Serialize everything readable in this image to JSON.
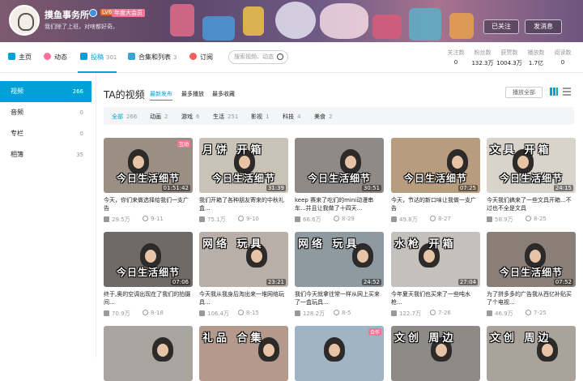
{
  "header": {
    "username": "摸鱼事务所",
    "level": "LV6",
    "vip_badge": "年度大会员",
    "signature": "我们除了上班，对啥都好奇。",
    "follow_label": "已关注",
    "message_label": "发消息"
  },
  "nav": {
    "items": [
      {
        "label": "主页",
        "count": ""
      },
      {
        "label": "动态",
        "count": ""
      },
      {
        "label": "投稿",
        "count": "301"
      },
      {
        "label": "合集和列表",
        "count": "3"
      },
      {
        "label": "订阅",
        "count": ""
      }
    ],
    "search_placeholder": "搜索视频、动态",
    "stats": [
      {
        "label": "关注数",
        "value": "0"
      },
      {
        "label": "粉丝数",
        "value": "132.3万"
      },
      {
        "label": "获赞数",
        "value": "1004.3万"
      },
      {
        "label": "播放数",
        "value": "1.7亿"
      },
      {
        "label": "阅读数",
        "value": "0"
      }
    ]
  },
  "sidebar": {
    "items": [
      {
        "label": "视频",
        "count": "266"
      },
      {
        "label": "音频",
        "count": "0"
      },
      {
        "label": "专栏",
        "count": "0"
      },
      {
        "label": "相簿",
        "count": "35"
      }
    ]
  },
  "main": {
    "title": "TA的视频",
    "sorts": [
      "最新发布",
      "最多播放",
      "最多收藏"
    ],
    "play_all_label": "播放全部",
    "filters": [
      {
        "label": "全部",
        "count": "266"
      },
      {
        "label": "动画",
        "count": "2"
      },
      {
        "label": "游戏",
        "count": "6"
      },
      {
        "label": "生活",
        "count": "251"
      },
      {
        "label": "影视",
        "count": "1"
      },
      {
        "label": "科技",
        "count": "4"
      },
      {
        "label": "美食",
        "count": "2"
      }
    ],
    "videos": [
      {
        "cap": "今日生活细节",
        "top": "",
        "tag": "互动",
        "duration": "01:51:42",
        "title": "今天，你们来做选择给我们一支广告",
        "plays": "29.5万",
        "date": "9-11"
      },
      {
        "cap": "今日生活细节",
        "top": "月饼 开箱",
        "tag": "",
        "duration": "31:39",
        "title": "我们开箱了各种朋友寄来的中秋礼盒...",
        "plays": "75.1万",
        "date": "9-10"
      },
      {
        "cap": "今日生活细节",
        "top": "",
        "tag": "",
        "duration": "30:51",
        "title": "keep 赛来了吃们的mini动漫串车...并且让我做了十四天...",
        "plays": "66.6万",
        "date": "8-29"
      },
      {
        "cap": "今日生活细节",
        "top": "",
        "tag": "",
        "duration": "07:25",
        "title": "今天，节达的新口味让我做一支广告",
        "plays": "49.8万",
        "date": "8-27"
      },
      {
        "cap": "今日生活细节",
        "top": "文具 开箱",
        "tag": "",
        "duration": "24:15",
        "title": "今天我们搞来了一些文具开箱...不过也不全是文具",
        "plays": "58.9万",
        "date": "8-25"
      },
      {
        "cap": "今日生活细节",
        "top": "",
        "tag": "",
        "duration": "07:06",
        "title": "终于,奥的空调出现在了我们的拍摄间...",
        "plays": "70.9万",
        "date": "8-18"
      },
      {
        "cap": "",
        "top": "网络 玩具",
        "tag": "",
        "duration": "23:21",
        "title": "今天我从我身后淘出来一堆网络玩具...",
        "plays": "106.4万",
        "date": "8-15"
      },
      {
        "cap": "",
        "top": "网络 玩具",
        "tag": "",
        "duration": "24:52",
        "title": "我们今天就拿往常一样从网上买来了一盒玩具...",
        "plays": "128.2万",
        "date": "8-5"
      },
      {
        "cap": "",
        "top": "水枪 开箱",
        "tag": "",
        "duration": "27:04",
        "title": "今年夏天我们也买来了一些吨水枪...",
        "plays": "122.7万",
        "date": "7-26"
      },
      {
        "cap": "今日生活细节",
        "top": "",
        "tag": "",
        "duration": "07:52",
        "title": "为了拼多多的广告我从西亿补贴买了个电视...",
        "plays": "46.9万",
        "date": "7-25"
      },
      {
        "cap": "",
        "top": "",
        "tag": "",
        "duration": "",
        "title": "",
        "plays": "",
        "date": ""
      },
      {
        "cap": "",
        "top": "礼品 合集",
        "tag": "",
        "duration": "",
        "title": "",
        "plays": "",
        "date": ""
      },
      {
        "cap": "",
        "top": "",
        "tag": "合作",
        "duration": "",
        "title": "",
        "plays": "",
        "date": ""
      },
      {
        "cap": "",
        "top": "文创 周边",
        "tag": "",
        "duration": "",
        "title": "",
        "plays": "",
        "date": ""
      },
      {
        "cap": "",
        "top": "文创 周边",
        "tag": "",
        "duration": "",
        "title": "",
        "plays": "",
        "date": ""
      }
    ]
  },
  "colors": {
    "accent": "#00a1d6",
    "pink": "#fb7299",
    "muted": "#999999"
  }
}
